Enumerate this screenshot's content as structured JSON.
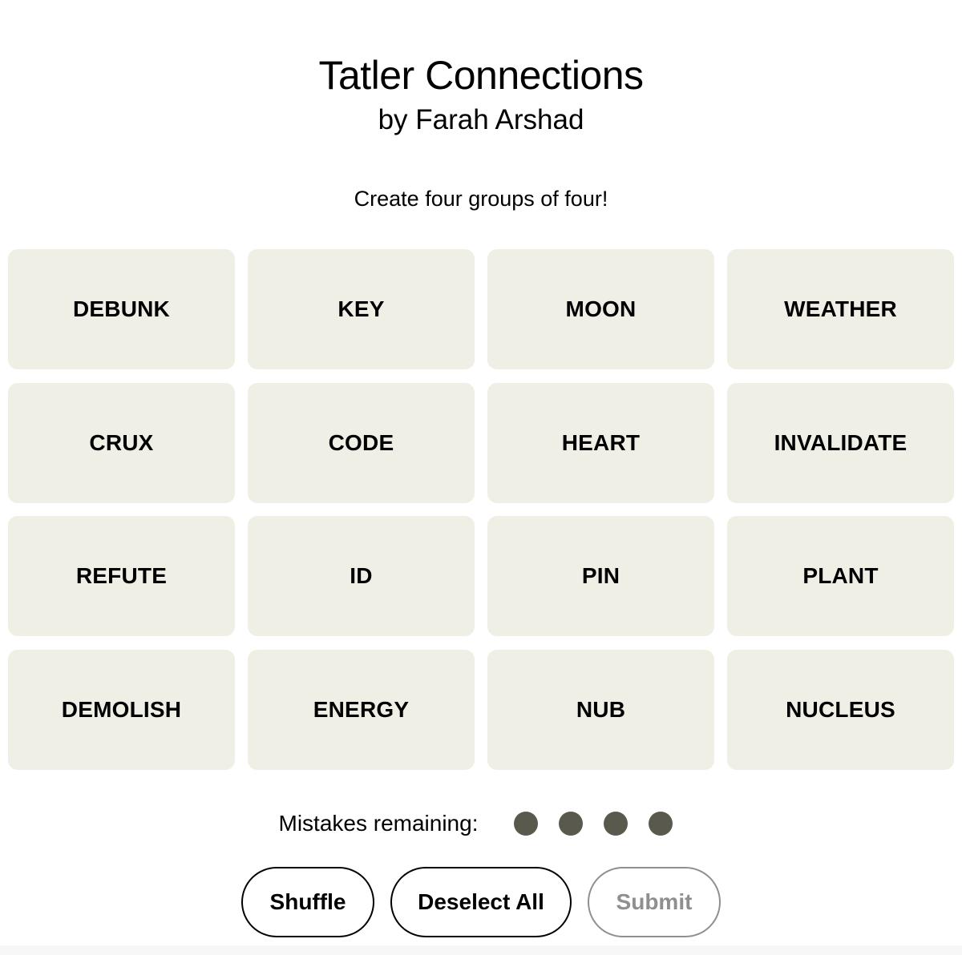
{
  "header": {
    "title": "Tatler Connections",
    "byline": "by Farah Arshad",
    "instructions": "Create four groups of four!"
  },
  "tiles": [
    "DEBUNK",
    "KEY",
    "MOON",
    "WEATHER",
    "CRUX",
    "CODE",
    "HEART",
    "INVALIDATE",
    "REFUTE",
    "ID",
    "PIN",
    "PLANT",
    "DEMOLISH",
    "ENERGY",
    "NUB",
    "NUCLEUS"
  ],
  "mistakes": {
    "label": "Mistakes remaining:",
    "remaining": 4,
    "dot_color": "#5a594e"
  },
  "actions": {
    "shuffle_label": "Shuffle",
    "deselect_label": "Deselect All",
    "submit_label": "Submit",
    "submit_enabled": false
  },
  "colors": {
    "tile_bg": "#efefe6",
    "disabled": "#8f8f8f"
  }
}
